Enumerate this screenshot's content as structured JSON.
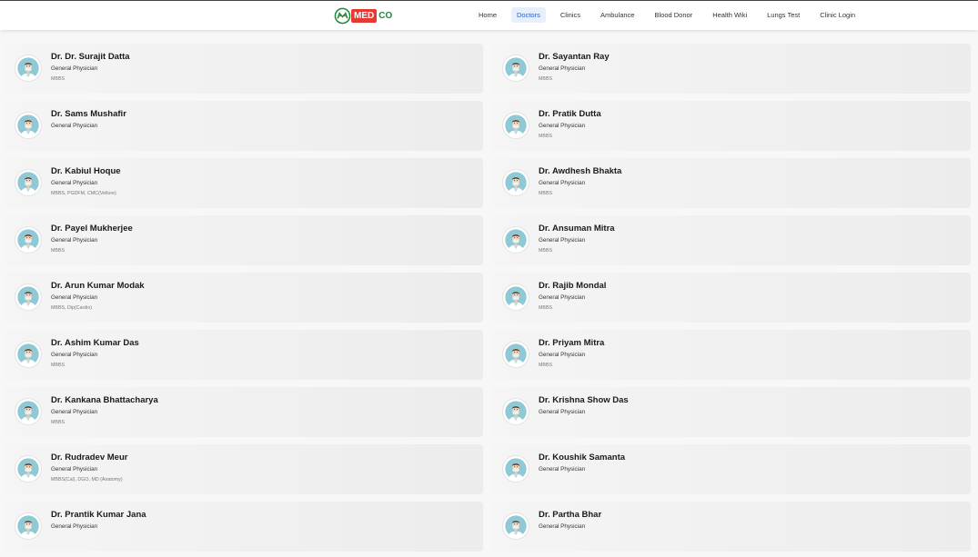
{
  "header": {
    "logo_med": "MED",
    "logo_co": "CO",
    "nav": [
      "Home",
      "Doctors",
      "Clinics",
      "Ambulance",
      "Blood Donor",
      "Health Wiki",
      "Lungs Test",
      "Clinic Login"
    ],
    "active_index": 1
  },
  "colors": {
    "logo_red": "#e53935",
    "logo_green": "#1b8a3a",
    "active_nav": "#2c63c4"
  },
  "doctors": [
    {
      "name": "Dr. Dr. Surajit Datta",
      "specialty": "General Physician",
      "qualification": "MBBS"
    },
    {
      "name": "Dr. Sayantan Ray",
      "specialty": "General Physician",
      "qualification": "MBBS"
    },
    {
      "name": "Dr. Sams Mushafir",
      "specialty": "General Physician",
      "qualification": ""
    },
    {
      "name": "Dr. Pratik Dutta",
      "specialty": "General Physician",
      "qualification": "MBBS"
    },
    {
      "name": "Dr. Kabiul Hoque",
      "specialty": "General Physician",
      "qualification": "MBBS, PGDFM, CMC(Vellore)"
    },
    {
      "name": "Dr. Awdhesh Bhakta",
      "specialty": "General Physician",
      "qualification": "MBBS"
    },
    {
      "name": "Dr. Payel Mukherjee",
      "specialty": "General Physician",
      "qualification": "MBBS"
    },
    {
      "name": "Dr. Ansuman Mitra",
      "specialty": "General Physician",
      "qualification": "MBBS"
    },
    {
      "name": "Dr. Arun Kumar Modak",
      "specialty": "General Physician",
      "qualification": "MBBS, Dip(Cardio)"
    },
    {
      "name": "Dr. Rajib Mondal",
      "specialty": "General Physician",
      "qualification": "MBBS"
    },
    {
      "name": "Dr. Ashim Kumar Das",
      "specialty": "General Physician",
      "qualification": "MBBS"
    },
    {
      "name": "Dr. Priyam Mitra",
      "specialty": "General Physician",
      "qualification": "MBBS"
    },
    {
      "name": "Dr. Kankana Bhattacharya",
      "specialty": "General Physician",
      "qualification": "MBBS"
    },
    {
      "name": "Dr. Krishna Show Das",
      "specialty": "General Physician",
      "qualification": ""
    },
    {
      "name": "Dr. Rudradev Meur",
      "specialty": "General Physician",
      "qualification": "MBBS(Cal), DGO, MD (Anatomy)"
    },
    {
      "name": "Dr. Koushik Samanta",
      "specialty": "General Physician",
      "qualification": ""
    },
    {
      "name": "Dr. Prantik Kumar Jana",
      "specialty": "General Physician",
      "qualification": ""
    },
    {
      "name": "Dr. Partha Bhar",
      "specialty": "General Physician",
      "qualification": ""
    }
  ]
}
